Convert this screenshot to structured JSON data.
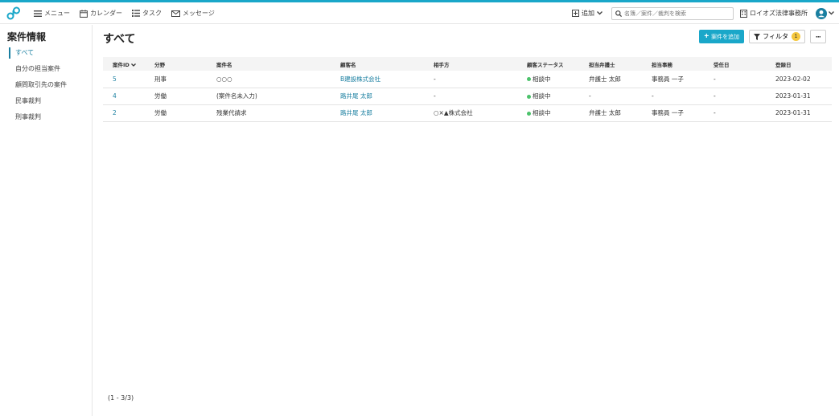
{
  "colors": {
    "accent": "#1aa7c9",
    "link": "#1a7fa0",
    "status_dot": "#4cc26b",
    "badge": "#f5c73d"
  },
  "nav": {
    "menu": "メニュー",
    "calendar": "カレンダー",
    "task": "タスク",
    "message": "メッセージ"
  },
  "header": {
    "add": "追加",
    "search_placeholder": "名簿／案件／裁判を検索",
    "office": "ロイオズ法律事務所"
  },
  "sidebar": {
    "title": "案件情報",
    "items": [
      {
        "label": "すべて"
      },
      {
        "label": "自分の担当案件"
      },
      {
        "label": "顧問取引先の案件"
      },
      {
        "label": "民事裁判"
      },
      {
        "label": "刑事裁判"
      }
    ]
  },
  "main": {
    "title": "すべて",
    "add_case_label": "案件を追加",
    "filter_label": "フィルタ",
    "filter_count": "1",
    "more_label": "···",
    "pager": "(1 - 3/3)"
  },
  "table": {
    "headers": [
      "案件ID",
      "分野",
      "案件名",
      "顧客名",
      "相手方",
      "顧客ステータス",
      "担当弁護士",
      "担当事務",
      "受任日",
      "登録日"
    ],
    "rows": [
      {
        "id": "5",
        "field": "刑事",
        "name": "○○○",
        "client": "B建設株式会社",
        "opponent": "-",
        "status": "相談中",
        "lawyer": "弁護士 太郎",
        "clerk": "事務員 一子",
        "accepted": "-",
        "registered": "2023-02-02"
      },
      {
        "id": "4",
        "field": "労働",
        "name": "(案件名未入力)",
        "client": "路井尾 太郎",
        "opponent": "-",
        "status": "相談中",
        "lawyer": "-",
        "clerk": "-",
        "accepted": "-",
        "registered": "2023-01-31"
      },
      {
        "id": "2",
        "field": "労働",
        "name": "残業代請求",
        "client": "路井尾 太郎",
        "opponent": "○×▲株式会社",
        "status": "相談中",
        "lawyer": "弁護士 太郎",
        "clerk": "事務員 一子",
        "accepted": "-",
        "registered": "2023-01-31"
      }
    ]
  }
}
